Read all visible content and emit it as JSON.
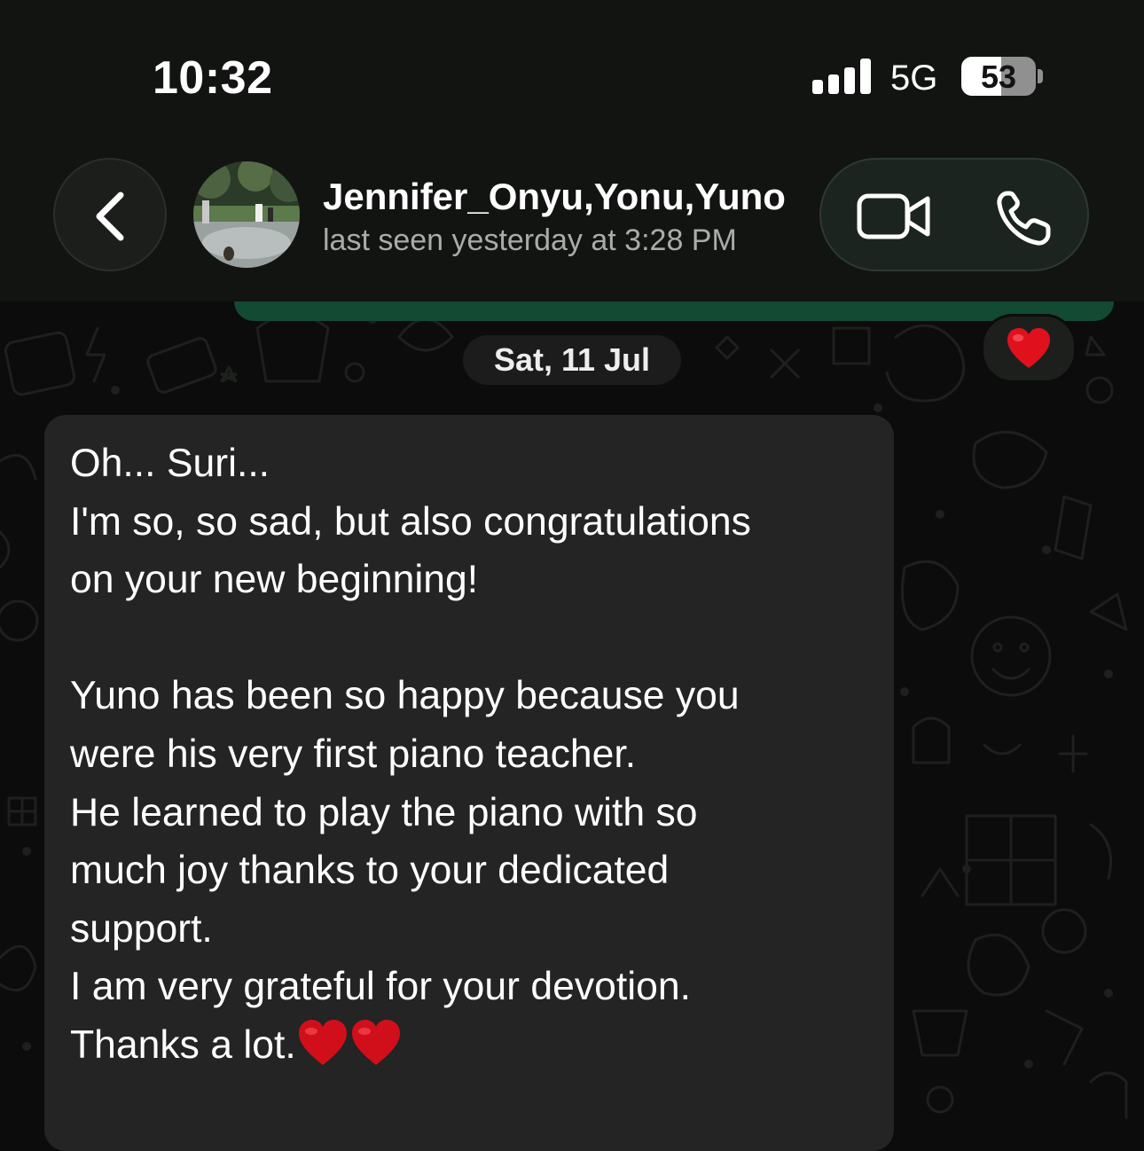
{
  "status_bar": {
    "time": "10:32",
    "network": "5G",
    "battery": "53",
    "battery_level": 0.53,
    "signal_bars": 4
  },
  "header": {
    "contact_name": "Jennifer_Onyu,Yonu,Yuno",
    "last_seen": "last seen yesterday at 3:28 PM",
    "back_icon": "chevron-left-icon",
    "video_icon": "video-camera-icon",
    "call_icon": "phone-icon"
  },
  "chat": {
    "previous_reaction": "❤️",
    "date_separator": "Sat, 11 Jul",
    "incoming_message": {
      "lines": [
        "Oh... Suri...",
        "I'm so, so sad, but also congratulations",
        "on your new beginning!",
        "",
        "Yuno has been so happy because you",
        "were his very first piano teacher.",
        "He learned to play the piano with so",
        "much joy thanks to your dedicated",
        "support.",
        "I am very grateful for your devotion.",
        "Thanks a lot."
      ],
      "trailing_emoji": "❤️❤️"
    }
  },
  "colors": {
    "background": "#0b0c0b",
    "header": "#121412",
    "incoming_bubble": "#232423",
    "outgoing_bubble": "#124a33",
    "heart": "#e0111d"
  }
}
